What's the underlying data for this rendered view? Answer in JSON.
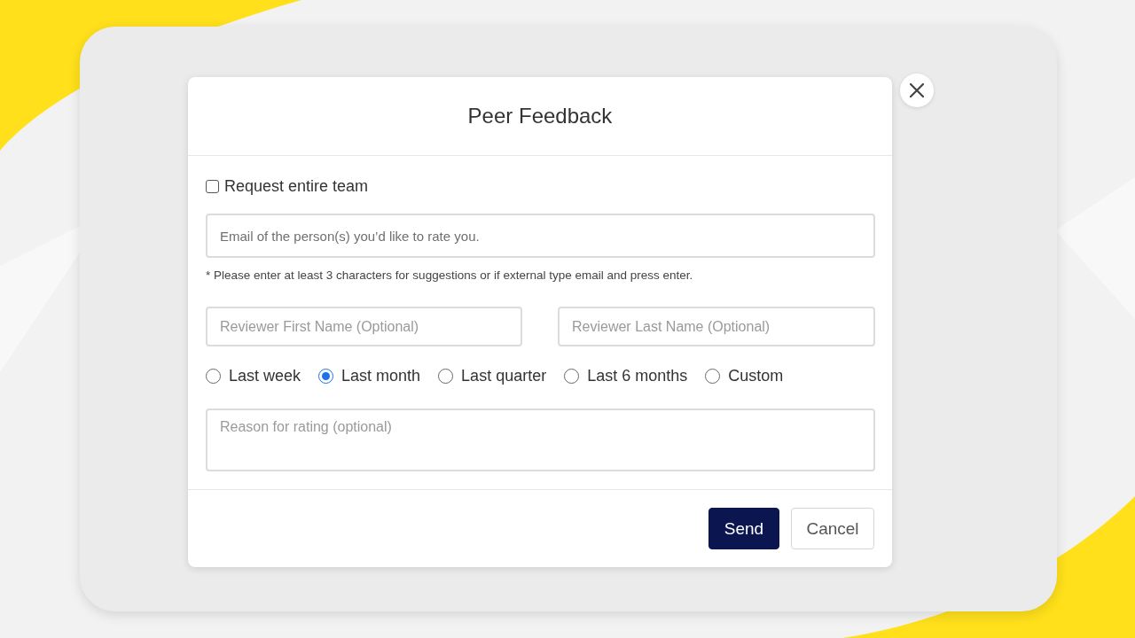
{
  "dialog": {
    "title": "Peer Feedback"
  },
  "request_team": {
    "label": "Request entire team",
    "checked": false
  },
  "email_field": {
    "placeholder": "Email of the person(s) you’d like to rate you."
  },
  "hint": "* Please enter at least 3 characters for suggestions or if external type email and press enter.",
  "name_fields": [
    {
      "placeholder": "Reviewer First Name (Optional)"
    },
    {
      "placeholder": "Reviewer Last Name (Optional)"
    }
  ],
  "periods": [
    {
      "label": "Last week",
      "selected": false
    },
    {
      "label": "Last month",
      "selected": true
    },
    {
      "label": "Last quarter",
      "selected": false
    },
    {
      "label": "Last 6 months",
      "selected": false
    },
    {
      "label": "Custom",
      "selected": false
    }
  ],
  "reason_field": {
    "placeholder": "Reason for rating (optional)"
  },
  "buttons": [
    {
      "label": "Send",
      "kind": "primary"
    },
    {
      "label": "Cancel",
      "kind": "secondary"
    }
  ]
}
